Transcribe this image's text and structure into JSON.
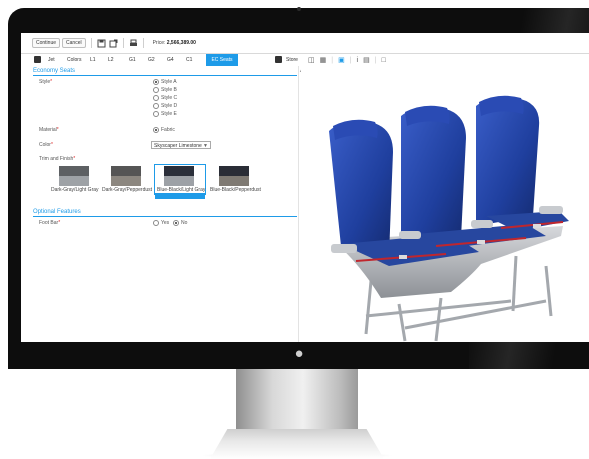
{
  "toolbar": {
    "continue_label": "Continue",
    "cancel_label": "Cancel",
    "price_label": "Price:",
    "price_value": "2,566,389.00"
  },
  "tabs": [
    {
      "label": "Jet"
    },
    {
      "label": "Colors"
    },
    {
      "label": "L1"
    },
    {
      "label": "L2"
    },
    {
      "label": "G1"
    },
    {
      "label": "G2"
    },
    {
      "label": "G4"
    },
    {
      "label": "C1"
    },
    {
      "label": "EC Seats",
      "active": true
    },
    {
      "label": "Store"
    }
  ],
  "economy": {
    "title": "Economy Seats",
    "style": {
      "label": "Style",
      "options": [
        "Style A",
        "Style B",
        "Style C",
        "Style D",
        "Style E"
      ],
      "selected": "Style A"
    },
    "material": {
      "label": "Material",
      "options": [
        "Fabric"
      ],
      "selected": "Fabric"
    },
    "color": {
      "label": "Color",
      "value": "Skyscaper Limestone"
    },
    "trim": {
      "label": "Trim and Finish",
      "options": [
        {
          "label": "Dark-Gray/Light Gray",
          "top": "#5d6063",
          "bottom": "#9ea2a6"
        },
        {
          "label": "Dark-Gray/Pepperdust",
          "top": "#555555",
          "bottom": "#8c8780"
        },
        {
          "label": "Blue-Black/Light Gray",
          "top": "#2b2f3a",
          "bottom": "#9da1a6"
        },
        {
          "label": "Blue-Black/Pepperdust",
          "top": "#2a2d36",
          "bottom": "#7f7a73"
        }
      ],
      "selected_index": 2
    }
  },
  "optional": {
    "title": "Optional Features",
    "foot_bar": {
      "label": "Foot Bar",
      "options": [
        "Yes",
        "No"
      ],
      "selected": "No"
    }
  },
  "colors": {
    "accent": "#1e9be8",
    "seat_blue": "#1f3f9e",
    "required": "#dd2222"
  }
}
